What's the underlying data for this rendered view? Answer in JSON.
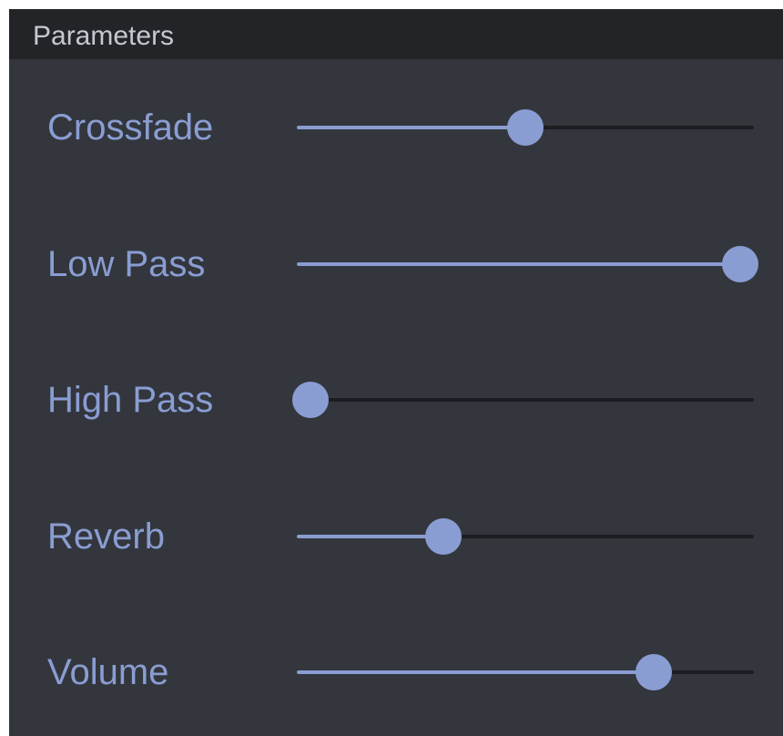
{
  "panel": {
    "title": "Parameters"
  },
  "parameters": [
    {
      "label": "Crossfade",
      "value": 0.5
    },
    {
      "label": "Low Pass",
      "value": 0.97
    },
    {
      "label": "High Pass",
      "value": 0.03
    },
    {
      "label": "Reverb",
      "value": 0.32
    },
    {
      "label": "Volume",
      "value": 0.78
    }
  ],
  "colors": {
    "panel_background": "#33363c",
    "header_background": "#232428",
    "accent": "#8a9dd3",
    "track": "#1c1d21",
    "title_text": "#c4c8d1"
  }
}
